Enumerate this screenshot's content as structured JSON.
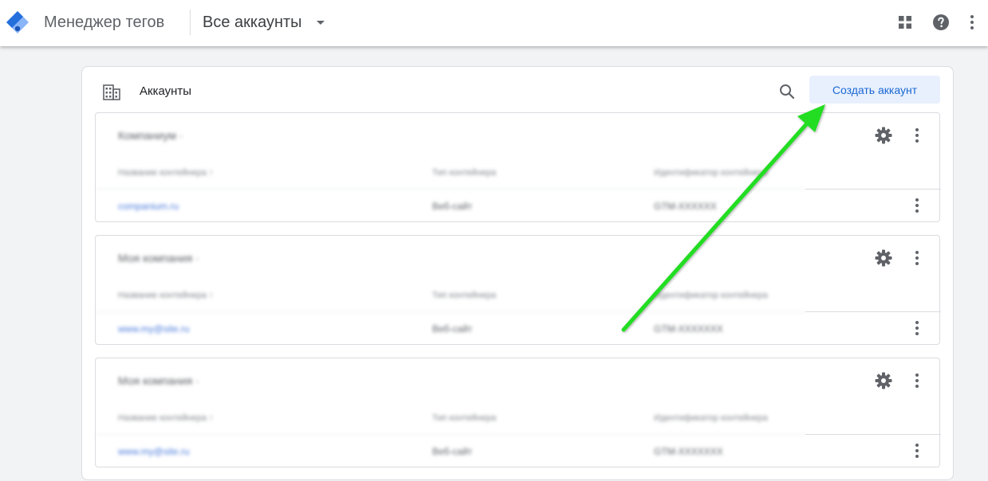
{
  "header": {
    "product_name": "Менеджер тегов",
    "account_switcher": "Все аккаунты",
    "icons": [
      "apps-grid-icon",
      "help-icon",
      "more-vert-icon"
    ]
  },
  "main": {
    "title": "Аккаунты",
    "create_button": "Создать аккаунт",
    "accounts": [
      {
        "name": "Компаниум ·",
        "columns": [
          "Название контейнера ↑",
          "Тип контейнера",
          "Идентификатор контейнера"
        ],
        "rows": [
          {
            "container": "companium.ru",
            "type": "Веб-сайт",
            "id": "GTM-XXXXXX"
          }
        ]
      },
      {
        "name": "Моя компания ·",
        "columns": [
          "Название контейнера ↑",
          "Тип контейнера",
          "Идентификатор контейнера"
        ],
        "rows": [
          {
            "container": "www.my@site.ru",
            "type": "Веб-сайт",
            "id": "GTM-XXXXXXX"
          }
        ]
      },
      {
        "name": "Моя компания ·",
        "columns": [
          "Название контейнера ↑",
          "Тип контейнера",
          "Идентификатор контейнера"
        ],
        "rows": [
          {
            "container": "www.my@site.ru",
            "type": "Веб-сайт",
            "id": "GTM-XXXXXXX"
          }
        ]
      }
    ]
  },
  "colors": {
    "accent": "#1967d2",
    "button_bg": "#e8f0fe",
    "annotation_arrow": "#22dd22",
    "logo_dark": "#246fdb",
    "logo_light": "#8ab4f8"
  }
}
